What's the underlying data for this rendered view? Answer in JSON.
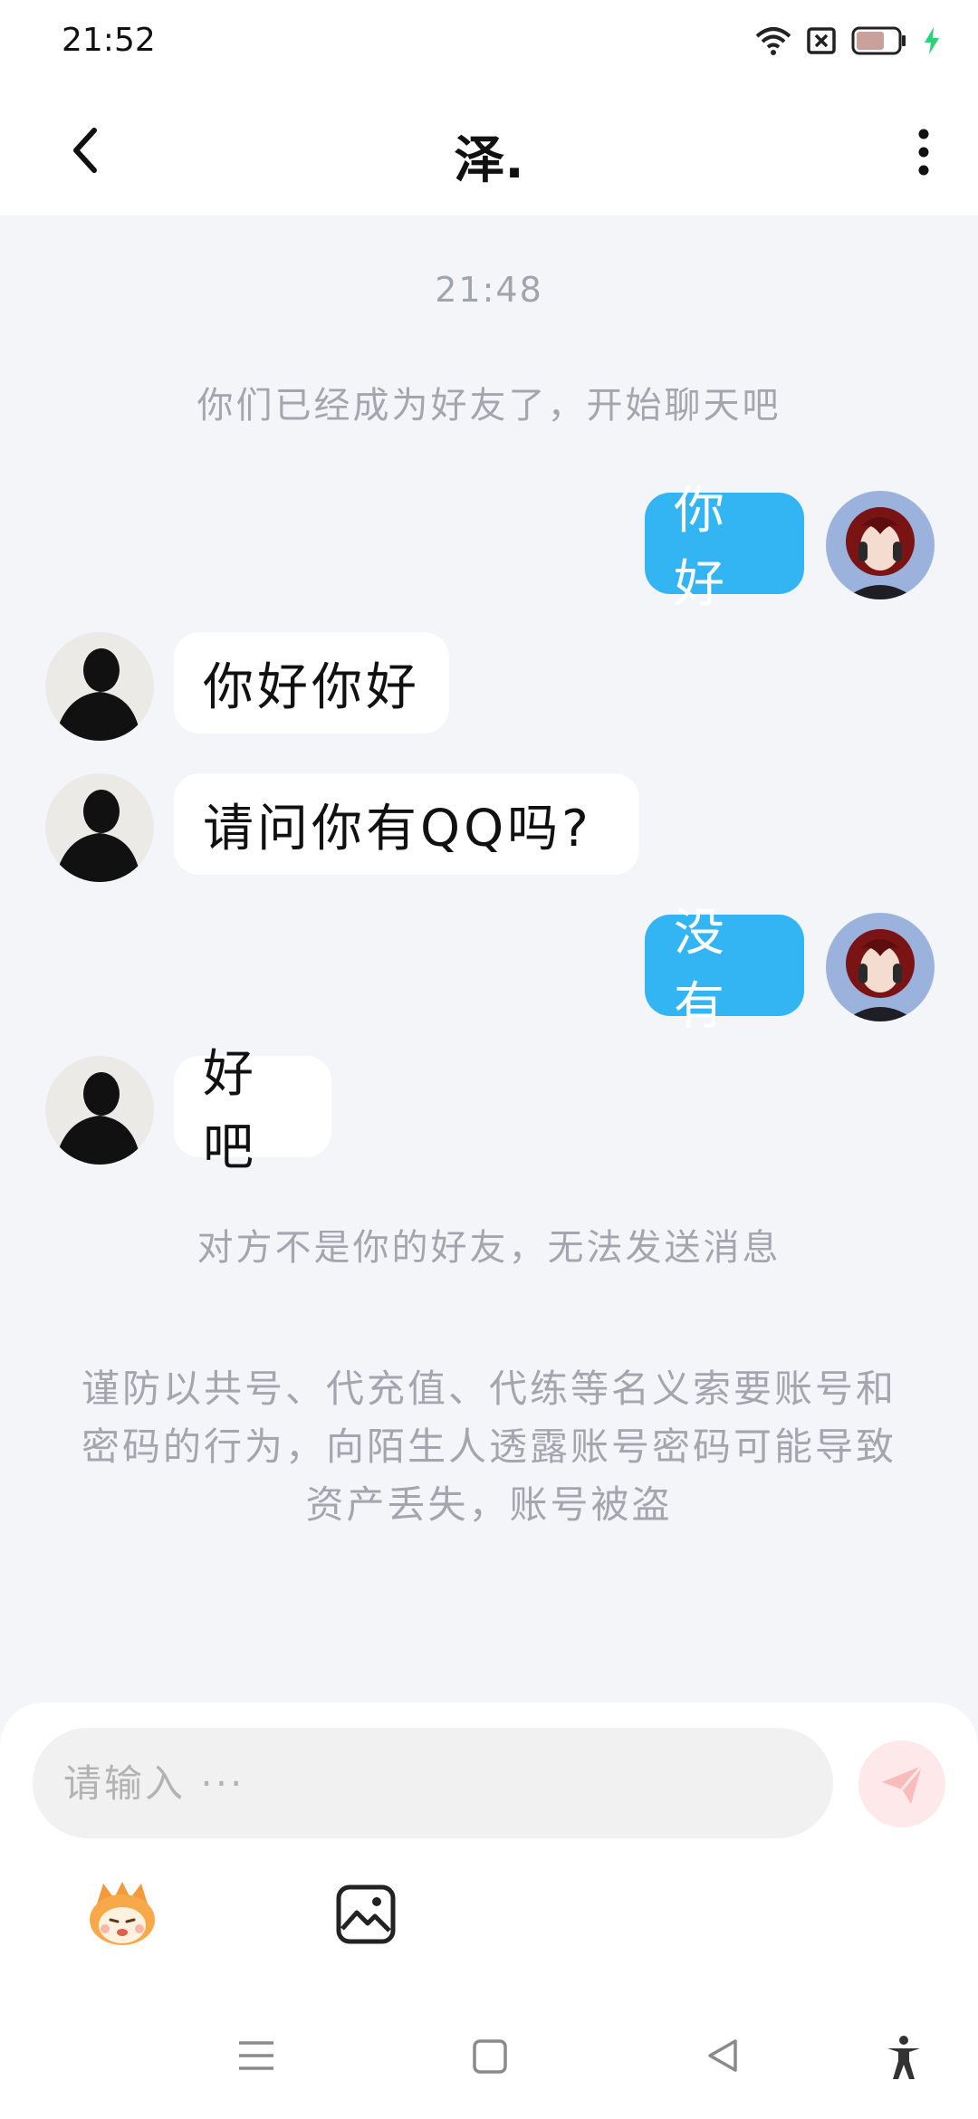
{
  "status_bar": {
    "time": "21:52",
    "battery_level": "61",
    "icons": [
      "wifi-icon",
      "sim-off-icon",
      "battery-icon",
      "charging-icon"
    ]
  },
  "header": {
    "title": "泽.",
    "back_icon": "chevron-left-icon",
    "more_icon": "more-vertical-icon"
  },
  "chat": {
    "timestamp": "21:48",
    "friend_notice": "你们已经成为好友了，开始聊天吧",
    "messages": [
      {
        "from": "me",
        "text": "你好"
      },
      {
        "from": "them",
        "text": "你好你好"
      },
      {
        "from": "them",
        "text": "请问你有QQ吗?"
      },
      {
        "from": "me",
        "text": "没有"
      },
      {
        "from": "them",
        "text": "好吧"
      }
    ],
    "not_friend_notice": "对方不是你的好友，无法发送消息",
    "warning": "谨防以共号、代充值、代练等名义索要账号和密码的行为，向陌生人透露账号密码可能导致资产丢失，账号被盗"
  },
  "composer": {
    "placeholder": "请输入 ···",
    "send_icon": "send-icon",
    "tools": [
      "emoji-sticker-icon",
      "image-icon"
    ]
  },
  "nav_bar": {
    "buttons": [
      "menu-icon",
      "home-icon",
      "back-triangle-icon",
      "accessibility-icon"
    ]
  },
  "colors": {
    "outgoing_bubble": "#33b5f4",
    "incoming_bubble": "#ffffff",
    "background": "#f3f5f9",
    "system_text": "#a3a6ad",
    "send_button": "#fde9e9"
  }
}
